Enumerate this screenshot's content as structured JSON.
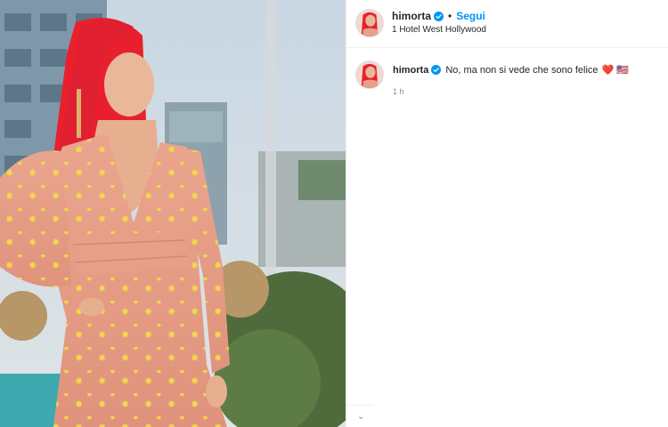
{
  "post": {
    "photo_alt": "foto del post",
    "author": {
      "username": "himorta",
      "verified": true,
      "follow_label": "Segui",
      "separator": "•",
      "location": "1 Hotel West Hollywood"
    },
    "caption": {
      "username": "himorta",
      "text": "No, ma non si vede che sono felice",
      "emojis": "❤️ 🇺🇸",
      "time": "1 h"
    }
  },
  "icons": {
    "verified": "verified-badge-icon",
    "more": "more-icon"
  },
  "colors": {
    "follow": "#0095f6",
    "verified": "#0095f6",
    "dress": "#e8a08a",
    "hair": "#e8202e"
  }
}
